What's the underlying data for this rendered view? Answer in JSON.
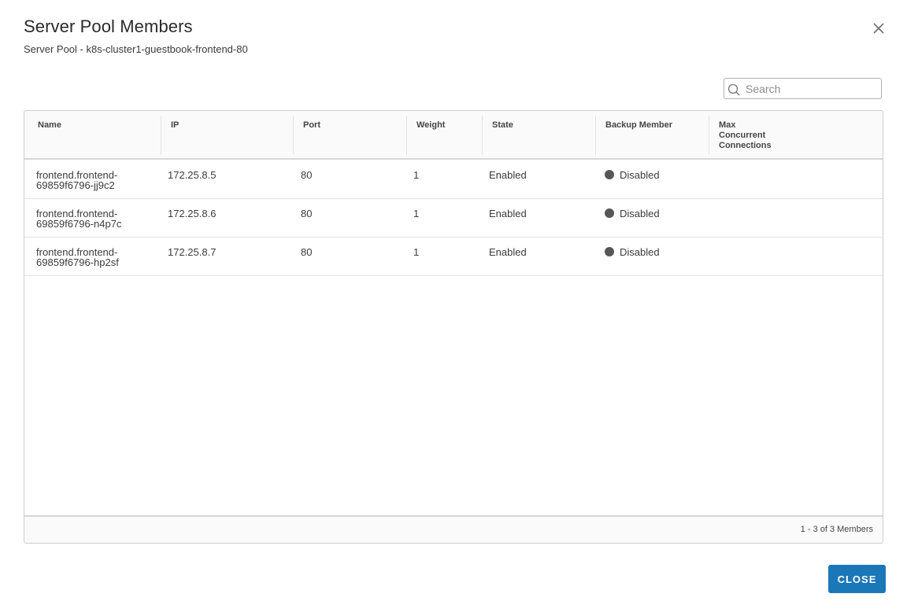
{
  "dialog": {
    "title": "Server Pool Members",
    "subtitle": "Server Pool - k8s-cluster1-guestbook-frontend-80",
    "close_icon": "close-icon",
    "close_button_label": "CLOSE",
    "accent_color": "#1b78b8"
  },
  "search": {
    "placeholder": "Search",
    "value": "",
    "icon": "search-icon"
  },
  "table": {
    "columns": [
      {
        "label": "Name"
      },
      {
        "label": "IP"
      },
      {
        "label": "Port"
      },
      {
        "label": "Weight"
      },
      {
        "label": "State"
      },
      {
        "label": "Backup Member"
      },
      {
        "label_lines": [
          "Max",
          "Concurrent",
          "Connections"
        ]
      }
    ],
    "rows": [
      {
        "name_line1": "frontend.frontend-",
        "name_line2": "69859f6796-jj9c2",
        "ip": "172.25.8.5",
        "port": "80",
        "weight": "1",
        "state": "Enabled",
        "backup": "Disabled",
        "backup_status_color": "#565656",
        "max_connections": ""
      },
      {
        "name_line1": "frontend.frontend-",
        "name_line2": "69859f6796-n4p7c",
        "ip": "172.25.8.6",
        "port": "80",
        "weight": "1",
        "state": "Enabled",
        "backup": "Disabled",
        "backup_status_color": "#565656",
        "max_connections": ""
      },
      {
        "name_line1": "frontend.frontend-",
        "name_line2": "69859f6796-hp2sf",
        "ip": "172.25.8.7",
        "port": "80",
        "weight": "1",
        "state": "Enabled",
        "backup": "Disabled",
        "backup_status_color": "#565656",
        "max_connections": ""
      }
    ],
    "footer": "1 - 3 of 3 Members"
  }
}
